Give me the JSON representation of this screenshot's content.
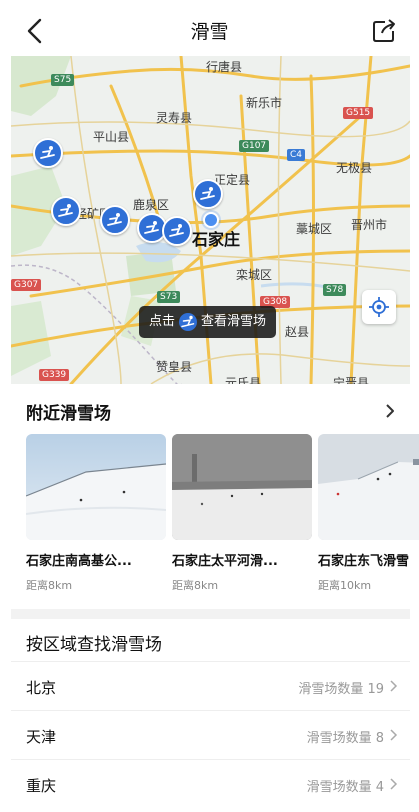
{
  "header": {
    "title": "滑雪"
  },
  "map": {
    "labels": {
      "xingtang": "行唐县",
      "lingshou": "灵寿县",
      "xinle": "新乐市",
      "pingshan": "平山县",
      "zhengding": "正定县",
      "wuji": "无极县",
      "luquan": "鹿泉区",
      "jingxing": "井陉矿区",
      "sjz": "石家庄",
      "gaocheng": "藁城区",
      "jinzhou": "晋州市",
      "luancheng": "栾城区",
      "zanhuang": "赞皇县",
      "zhaoxian": "赵县",
      "yuanshi": "元氏县",
      "ningjin": "宁晋县"
    },
    "roads": {
      "s75": "S75",
      "g107": "G107",
      "g515": "G515",
      "c4": "C4",
      "g307": "G307",
      "s73": "S73",
      "g308": "G308",
      "s78": "S78",
      "g339": "G339"
    },
    "tip_prefix": "点击",
    "tip_suffix": "查看滑雪场"
  },
  "nearby": {
    "title": "附近滑雪场",
    "cards": [
      {
        "name": "石家庄南高基公园滑雪场",
        "display_name": "石家庄南高基公...",
        "distance": "距离8km"
      },
      {
        "name": "石家庄太平河滑雪场",
        "display_name": "石家庄太平河滑...",
        "distance": "距离8km"
      },
      {
        "name": "石家庄东飞滑雪场",
        "display_name": "石家庄东飞滑雪",
        "distance": "距离10km"
      }
    ]
  },
  "regions": {
    "title": "按区域查找滑雪场",
    "items": [
      {
        "name": "北京",
        "count": "滑雪场数量 19"
      },
      {
        "name": "天津",
        "count": "滑雪场数量 8"
      },
      {
        "name": "重庆",
        "count": "滑雪场数量 4"
      }
    ]
  },
  "colors": {
    "accent": "#2f6fd6",
    "road_yellow": "#f1c24d",
    "road_red_shield": "#d9534f",
    "road_green_shield": "#3d8a5b",
    "road_blue_shield": "#3a7bd5"
  }
}
